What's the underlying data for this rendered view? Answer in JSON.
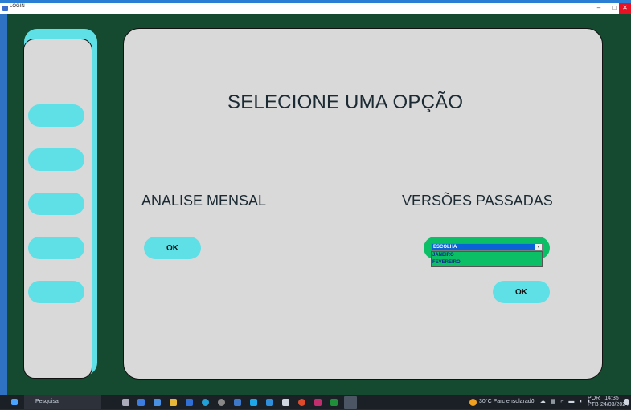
{
  "window": {
    "title": "LOGIN",
    "minimize": "–",
    "maximize": "□",
    "close": "✕"
  },
  "sidebar": {
    "buttons": [
      "",
      "",
      "",
      "",
      ""
    ]
  },
  "main": {
    "heading": "SELECIONE UMA OPÇÃO",
    "left_label": "ANALISE MENSAL",
    "right_label": "VERSÕES PASSADAS",
    "ok_left": "OK",
    "ok_right": "OK",
    "combo": {
      "selected": "ESCOLHA",
      "arrow": "▾",
      "options": [
        "JANEIRO",
        "FEVEREIRO"
      ]
    }
  },
  "taskbar": {
    "search_placeholder": "Pesquisar",
    "weather": "30°C  Parc ensolarado",
    "language": "POR",
    "keyboard": "PTB",
    "time": "14:35",
    "date": "24/03/2024"
  },
  "colors": {
    "accent_cyan": "#5fe0e6",
    "panel_gray": "#d9d9d9",
    "background_green": "#164a30",
    "combo_green": "#0bbf67"
  }
}
